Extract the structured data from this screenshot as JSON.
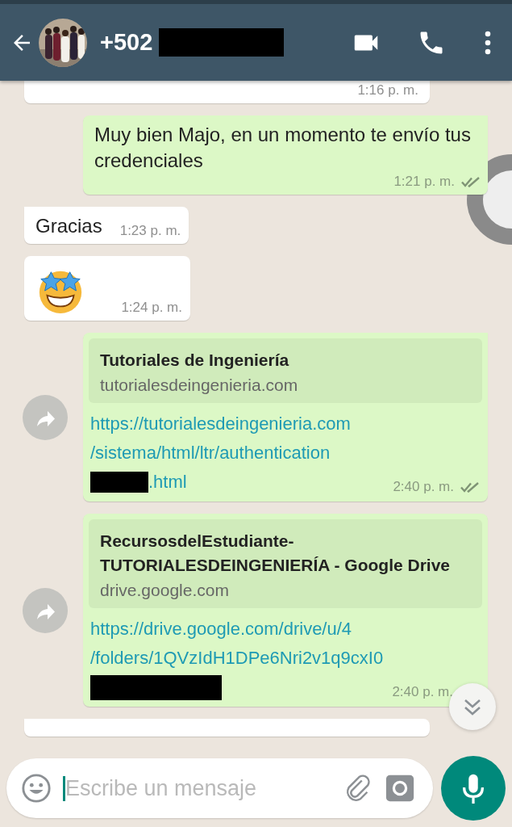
{
  "header": {
    "title": "+502",
    "number_redacted": true
  },
  "messages": [
    {
      "kind": "clipped",
      "outgoing": false,
      "time": "1:16 p. m."
    },
    {
      "kind": "text",
      "outgoing": true,
      "text": "Muy bien Majo, en un momento te envío tus credenciales",
      "time": "1:21 p. m.",
      "delivered": true,
      "tail": true
    },
    {
      "kind": "text",
      "outgoing": false,
      "text": "Gracias",
      "time": "1:23 p. m.",
      "tail": true
    },
    {
      "kind": "emoji",
      "outgoing": false,
      "time": "1:24 p. m.",
      "tail": false
    },
    {
      "kind": "link",
      "outgoing": true,
      "preview_title": "Tutoriales de Ingeniería",
      "preview_domain": "tutorialesdeingenieria.com",
      "link_lines": [
        {
          "text": "https://tutorialesdeingenieria.com",
          "redacted": false
        },
        {
          "text": "/sistema/html/ltr/authentication",
          "redacted": false
        },
        {
          "text": ".html",
          "redacted": true
        }
      ],
      "time": "2:40 p. m.",
      "delivered": true,
      "tail": true,
      "forward": true
    },
    {
      "kind": "link",
      "outgoing": true,
      "preview_title": "RecursosdelEstudiante-TUTORIALESDEINGENIERÍA - Google Drive",
      "preview_domain": "drive.google.com",
      "link_lines": [
        {
          "text": "https://drive.google.com/drive/u/4",
          "redacted": false
        },
        {
          "text": "/folders/1QVzIdH1DPe6Nri2v1q9cxI0",
          "redacted": false
        }
      ],
      "redacted_line": true,
      "time": "2:40 p. m.",
      "tail": false,
      "forward": true
    },
    {
      "kind": "clipped",
      "outgoing": false,
      "tail": true
    }
  ],
  "composer": {
    "placeholder": "Escribe un mensaje"
  }
}
